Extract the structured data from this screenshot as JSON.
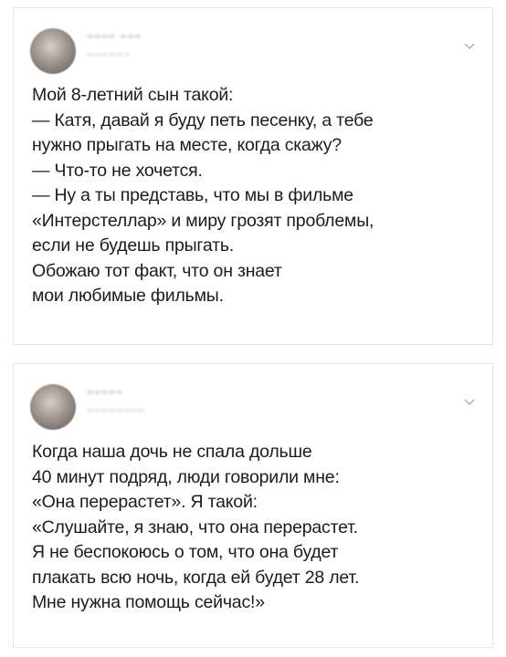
{
  "tweets": [
    {
      "author_name": "~~~~ ~~~",
      "author_handle": "~~~~~~",
      "lines": [
        "Мой 8-летний сын такой:",
        "— Катя, давай я буду петь песенку, а тебе",
        "нужно прыгать на месте, когда скажу?",
        "— Что-то не хочется.",
        "— Ну а ты представь, что мы в фильме",
        "«Интерстеллар» и миру грозят проблемы,",
        "если не будешь прыгать.",
        "Обожаю тот факт, что он знает",
        "мои любимые фильмы."
      ]
    },
    {
      "author_name": "~~~~~",
      "author_handle": "~~~~~~~~",
      "lines": [
        "Когда наша дочь не спала дольше",
        "40 минут подряд, люди говорили мне:",
        "«Она перерастет». Я такой:",
        "«Слушайте, я знаю, что она перерастет.",
        "Я не беспокоюсь о том, что она будет",
        "плакать всю ночь, когда ей будет 28 лет.",
        "Мне нужна помощь сейчас!»"
      ]
    }
  ],
  "icons": {
    "avatar": "avatar-icon",
    "menu": "chevron-down-icon"
  }
}
